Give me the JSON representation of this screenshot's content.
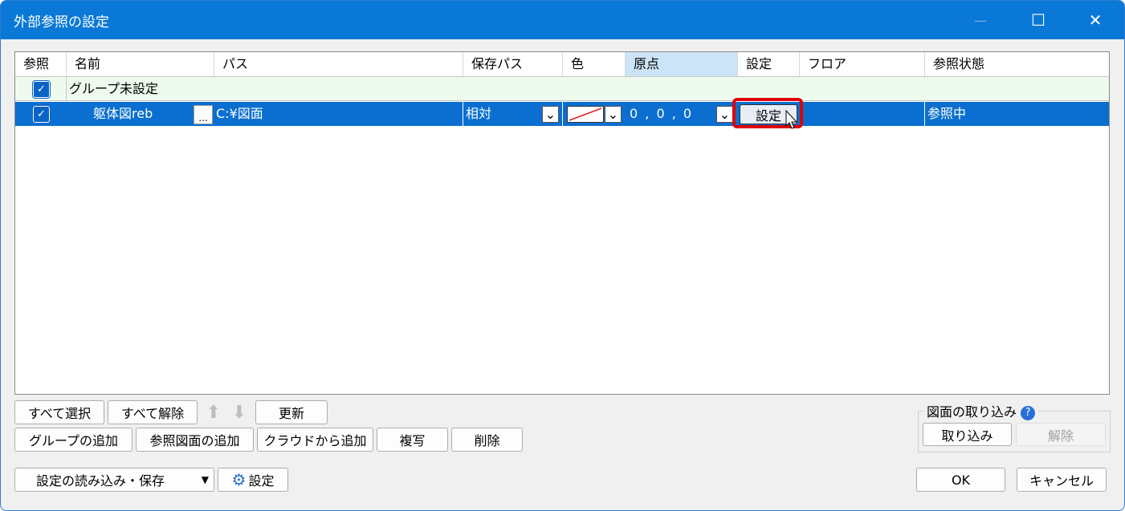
{
  "window": {
    "title": "外部参照の設定",
    "controls": {
      "minimize": "—",
      "maximize": "☐",
      "close": "✕"
    }
  },
  "grid": {
    "columns": [
      "参照",
      "名前",
      "パス",
      "保存パス",
      "色",
      "原点",
      "設定",
      "フロア",
      "参照状態"
    ],
    "selected_column": "原点",
    "group_row": {
      "checked": true,
      "name": "グループ未設定"
    },
    "rows": [
      {
        "checked": true,
        "name": "躯体図reb",
        "browse": "...",
        "path": "C:¥図面",
        "save_path": "相対",
        "color": "#e02020",
        "origin": "0 , 0 , 0",
        "settings_button": "設定",
        "floor": "",
        "status": "参照中"
      }
    ]
  },
  "buttons": {
    "select_all": "すべて選択",
    "deselect_all": "すべて解除",
    "update": "更新",
    "add_group": "グループの追加",
    "add_ref": "参照図面の追加",
    "add_cloud": "クラウドから追加",
    "copy": "複写",
    "delete": "削除",
    "load_save": "設定の読み込み・保存",
    "settings": "設定",
    "ok": "OK",
    "cancel": "キャンセル"
  },
  "import_group": {
    "title": "図面の取り込み",
    "import": "取り込み",
    "release": "解除"
  },
  "colors": {
    "accent": "#0a78d7",
    "highlight": "#e00000"
  }
}
